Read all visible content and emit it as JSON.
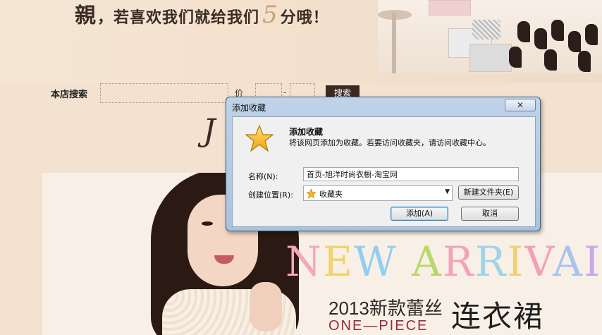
{
  "shop": {
    "slogan": {
      "lead": "親",
      "rest_1": "，若喜欢我们就给我们",
      "num": "5",
      "rest_2": "分哦！"
    },
    "search": {
      "label": "本店搜索",
      "price_label": "价格",
      "dash": "-",
      "button": "搜索"
    },
    "script_glyph": "J",
    "promo": {
      "headline_letters": [
        "N",
        "E",
        "W",
        " ",
        "A",
        "R",
        "R",
        "I",
        "V",
        "A",
        "I"
      ],
      "headline_colors": [
        "#f2a9b9",
        "#f1d46b",
        "#8fcfef",
        "#ffffff",
        "#b8d86b",
        "#f4a3b7",
        "#9fd3ea",
        "#f0d070",
        "#f3a0b5",
        "#a8c4ee",
        "#c9a6e8"
      ],
      "subtitle": "2013新款蕾丝",
      "subtitle_en": "ONE—PIECE",
      "subtitle_big": "连衣裙"
    }
  },
  "dialog": {
    "title": "添加收藏",
    "close": "✕",
    "heading": "添加收藏",
    "description": "将该网页添加为收藏。若要访问收藏夹，请访问收藏中心。",
    "name_label": "名称(N):",
    "name_value": "首页-旭洋时尚衣橱-淘宝网",
    "location_label": "创建位置(R):",
    "location_value": "收藏夹",
    "new_folder_button": "新建文件夹(E)",
    "add_button": "添加(A)",
    "cancel_button": "取消"
  }
}
